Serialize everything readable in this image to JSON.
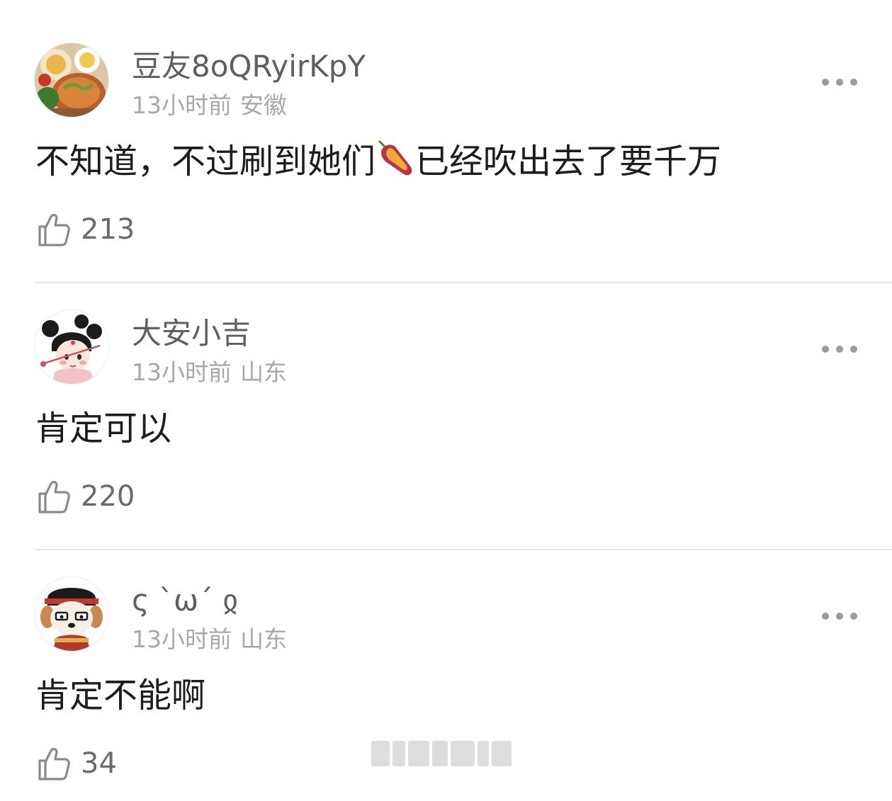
{
  "comments": [
    {
      "username": "豆友8oQRyirKpY",
      "time": "13小时前",
      "location": "安徽",
      "text_before": "不知道，不过刷到她们",
      "emoji": "sweet-potato-icon",
      "text_after": "已经吹出去了要千万",
      "likes": "213",
      "avatar": "food-photo-avatar"
    },
    {
      "username": "大安小吉",
      "time": "13小时前",
      "location": "山东",
      "text": "肯定可以",
      "likes": "220",
      "avatar": "cartoon-girl-avatar"
    },
    {
      "username": "ς ˋωˊ ჲ",
      "time": "13小时前",
      "location": "山东",
      "text": "肯定不能啊",
      "likes": "34",
      "avatar": "cartoon-dog-avatar"
    }
  ],
  "icons": {
    "more": "more-dots-icon",
    "like": "thumbs-up-icon"
  },
  "colors": {
    "username": "#5f5f5f",
    "meta": "#a8a8a8",
    "content": "#1d1d1d",
    "icon": "#9b9b9b",
    "divider": "#e7e7e7"
  }
}
